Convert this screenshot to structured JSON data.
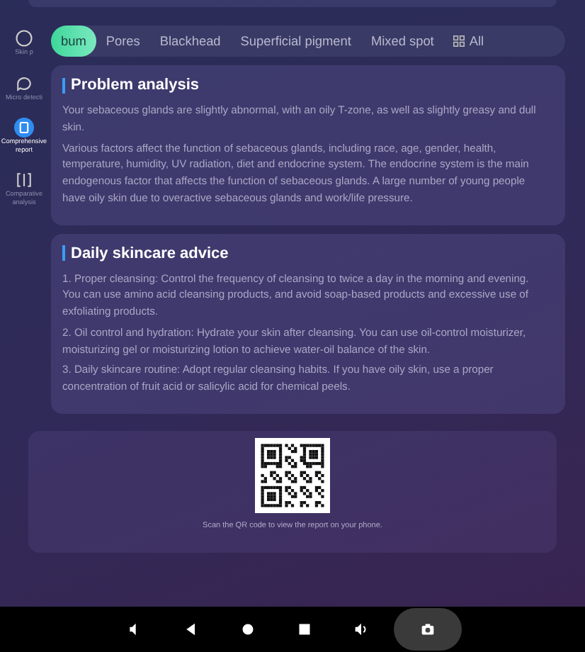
{
  "sidebar": {
    "items": [
      {
        "label": "Skin p",
        "selected": false
      },
      {
        "label": "Micro detecti",
        "selected": false
      },
      {
        "label": "Comprehensive report",
        "selected": true
      },
      {
        "label": "Comparative analysis",
        "selected": false
      }
    ]
  },
  "tabs": [
    {
      "label": "bum",
      "selected": true
    },
    {
      "label": "Pores",
      "selected": false
    },
    {
      "label": "Blackhead",
      "selected": false
    },
    {
      "label": "Superficial pigment",
      "selected": false
    },
    {
      "label": "Mixed spot",
      "selected": false
    },
    {
      "label": "All",
      "selected": false
    }
  ],
  "problem_analysis": {
    "title": "Problem analysis",
    "paragraphs": [
      "Your sebaceous glands are slightly abnormal, with an oily T-zone, as well as slightly greasy and dull skin.",
      "Various factors affect the function of sebaceous glands, including race, age, gender, health, temperature, humidity, UV radiation, diet and endocrine system. The endocrine system is the main endogenous factor that affects the function of sebaceous glands. A large number of young people have oily skin due to overactive sebaceous glands and work/life pressure."
    ]
  },
  "skincare_advice": {
    "title": "Daily skincare advice",
    "paragraphs": [
      "1. Proper cleansing: Control the frequency of cleansing to twice a day in the morning and evening. You can use amino acid cleansing products, and avoid soap-based products and excessive use of exfoliating products.",
      "2. Oil control and hydration: Hydrate your skin after cleansing. You can use oil-control moisturizer, moisturizing gel or moisturizing lotion to achieve water-oil balance of the skin.",
      "3. Daily skincare routine: Adopt regular cleansing habits. If you have oily skin, use a proper concentration of fruit acid or salicylic acid for chemical peels."
    ]
  },
  "qr": {
    "caption": "Scan the QR code to view the report on your phone."
  }
}
